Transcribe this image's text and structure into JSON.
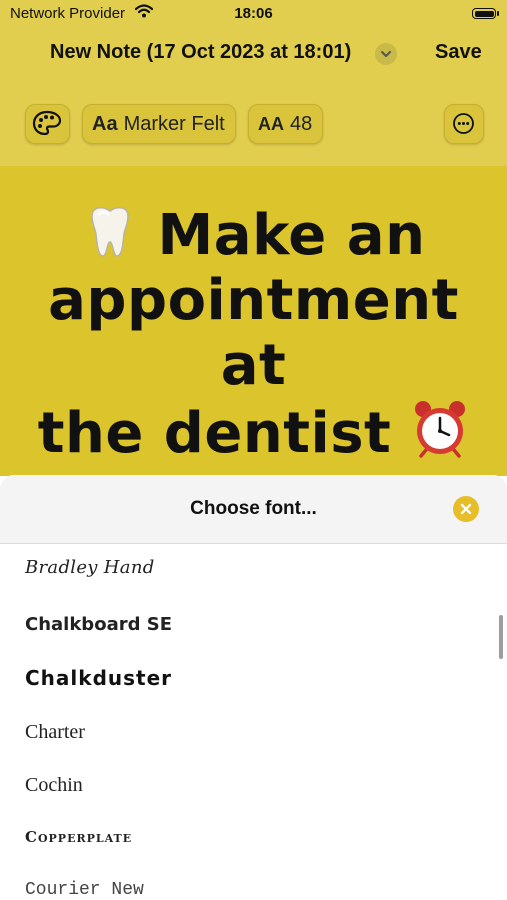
{
  "status_bar": {
    "carrier": "Network Provider",
    "time": "18:06"
  },
  "nav": {
    "title": "New Note (17 Oct 2023 at 18:01)",
    "save_label": "Save"
  },
  "toolbar": {
    "font_prefix": "Aa",
    "font_name": "Marker Felt",
    "size_prefix": "AA",
    "size_value": "48"
  },
  "note": {
    "line1_text": "Make an",
    "line2_text": "appointment at",
    "line3_text": "the dentist",
    "background_color": "#dcc42d"
  },
  "font_picker": {
    "title": "Choose font...",
    "fonts": [
      {
        "label": "Bradley Hand"
      },
      {
        "label": "Chalkboard SE"
      },
      {
        "label": "Chalkduster"
      },
      {
        "label": "Charter"
      },
      {
        "label": "Cochin"
      },
      {
        "label": "Copperplate"
      },
      {
        "label": "Courier New"
      }
    ]
  },
  "colors": {
    "toolbar_background": "#e1cd4e",
    "accent": "#e8bd2a"
  }
}
